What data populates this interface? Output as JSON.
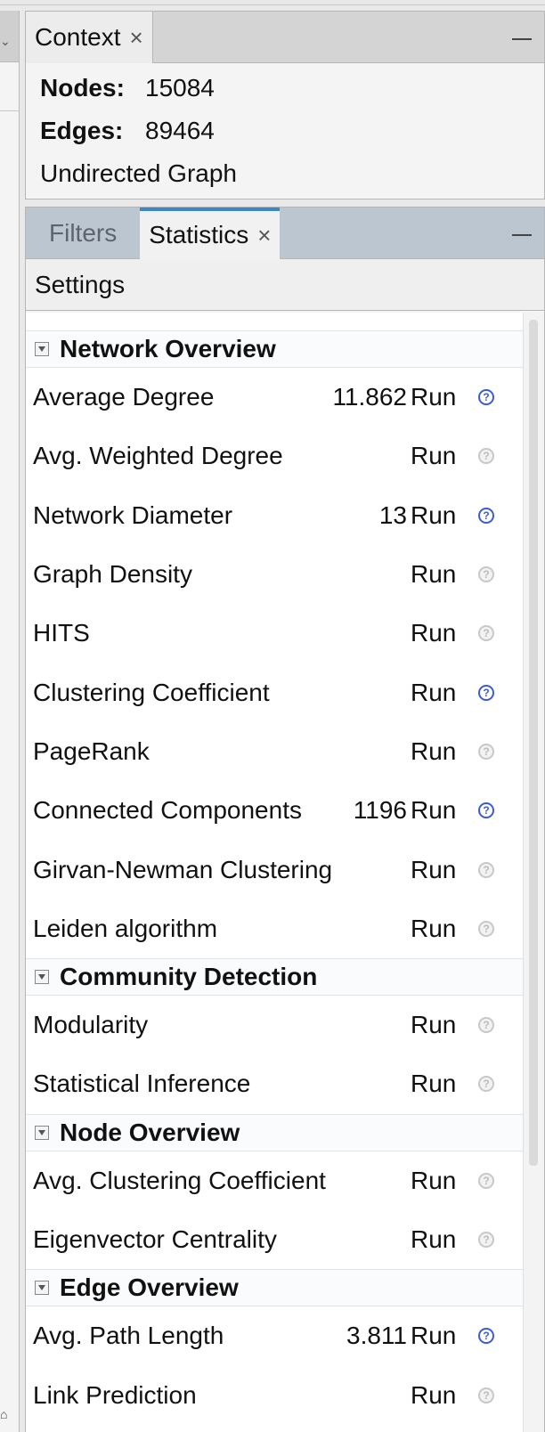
{
  "context_panel": {
    "tab_label": "Context",
    "close_glyph": "×",
    "nodes_label": "Nodes:",
    "nodes_value": "15084",
    "edges_label": "Edges:",
    "edges_value": "89464",
    "graph_type": "Undirected Graph"
  },
  "stats_panel": {
    "tabs": [
      {
        "label": "Filters"
      },
      {
        "label": "Statistics"
      }
    ],
    "close_glyph": "×",
    "settings_label": "Settings",
    "run_label": "Run",
    "groups": [
      {
        "title": "Network Overview",
        "rows": [
          {
            "name": "Average Degree",
            "value": "11.862"
          },
          {
            "name": "Avg. Weighted Degree",
            "value": ""
          },
          {
            "name": "Network Diameter",
            "value": "13"
          },
          {
            "name": "Graph Density",
            "value": ""
          },
          {
            "name": "HITS",
            "value": ""
          },
          {
            "name": "Clustering Coefficient",
            "value": ""
          },
          {
            "name": "PageRank",
            "value": ""
          },
          {
            "name": "Connected Components",
            "value": "1196"
          },
          {
            "name": "Girvan-Newman Clustering",
            "value": ""
          },
          {
            "name": "Leiden algorithm",
            "value": ""
          }
        ]
      },
      {
        "title": "Community Detection",
        "rows": [
          {
            "name": "Modularity",
            "value": ""
          },
          {
            "name": "Statistical Inference",
            "value": ""
          }
        ]
      },
      {
        "title": "Node Overview",
        "rows": [
          {
            "name": "Avg. Clustering Coefficient",
            "value": ""
          },
          {
            "name": "Eigenvector Centrality",
            "value": ""
          }
        ]
      },
      {
        "title": "Edge Overview",
        "rows": [
          {
            "name": "Avg. Path Length",
            "value": "3.811"
          },
          {
            "name": "Link Prediction",
            "value": ""
          }
        ]
      }
    ]
  },
  "colors": {
    "help_active": "#3b5bd8",
    "help_inactive": "#c8c8c8",
    "tab_accent": "#3b86c8"
  }
}
